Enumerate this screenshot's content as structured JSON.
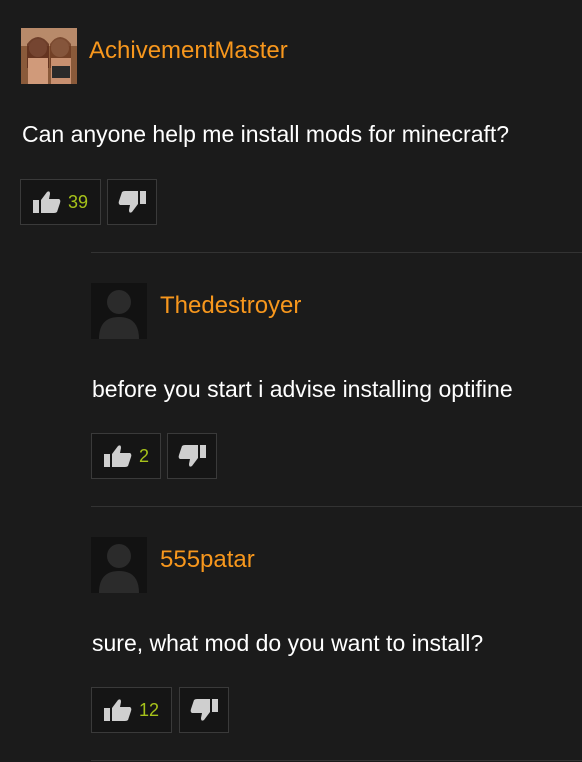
{
  "comments": [
    {
      "username": "AchivementMaster",
      "text": "Can anyone help me install mods for minecraft?",
      "upvotes": "39",
      "avatar": "photo-avatar"
    },
    {
      "username": "Thedestroyer",
      "text": "before you start i advise installing optifine",
      "upvotes": "2",
      "avatar": "default-user-avatar"
    },
    {
      "username": "555patar",
      "text": "sure, what mod do you want to install?",
      "upvotes": "12",
      "avatar": "default-user-avatar"
    }
  ],
  "colors": {
    "background": "#1b1b1b",
    "username": "#f7971d",
    "text": "#ffffff",
    "vote_count": "#a6c21a"
  }
}
